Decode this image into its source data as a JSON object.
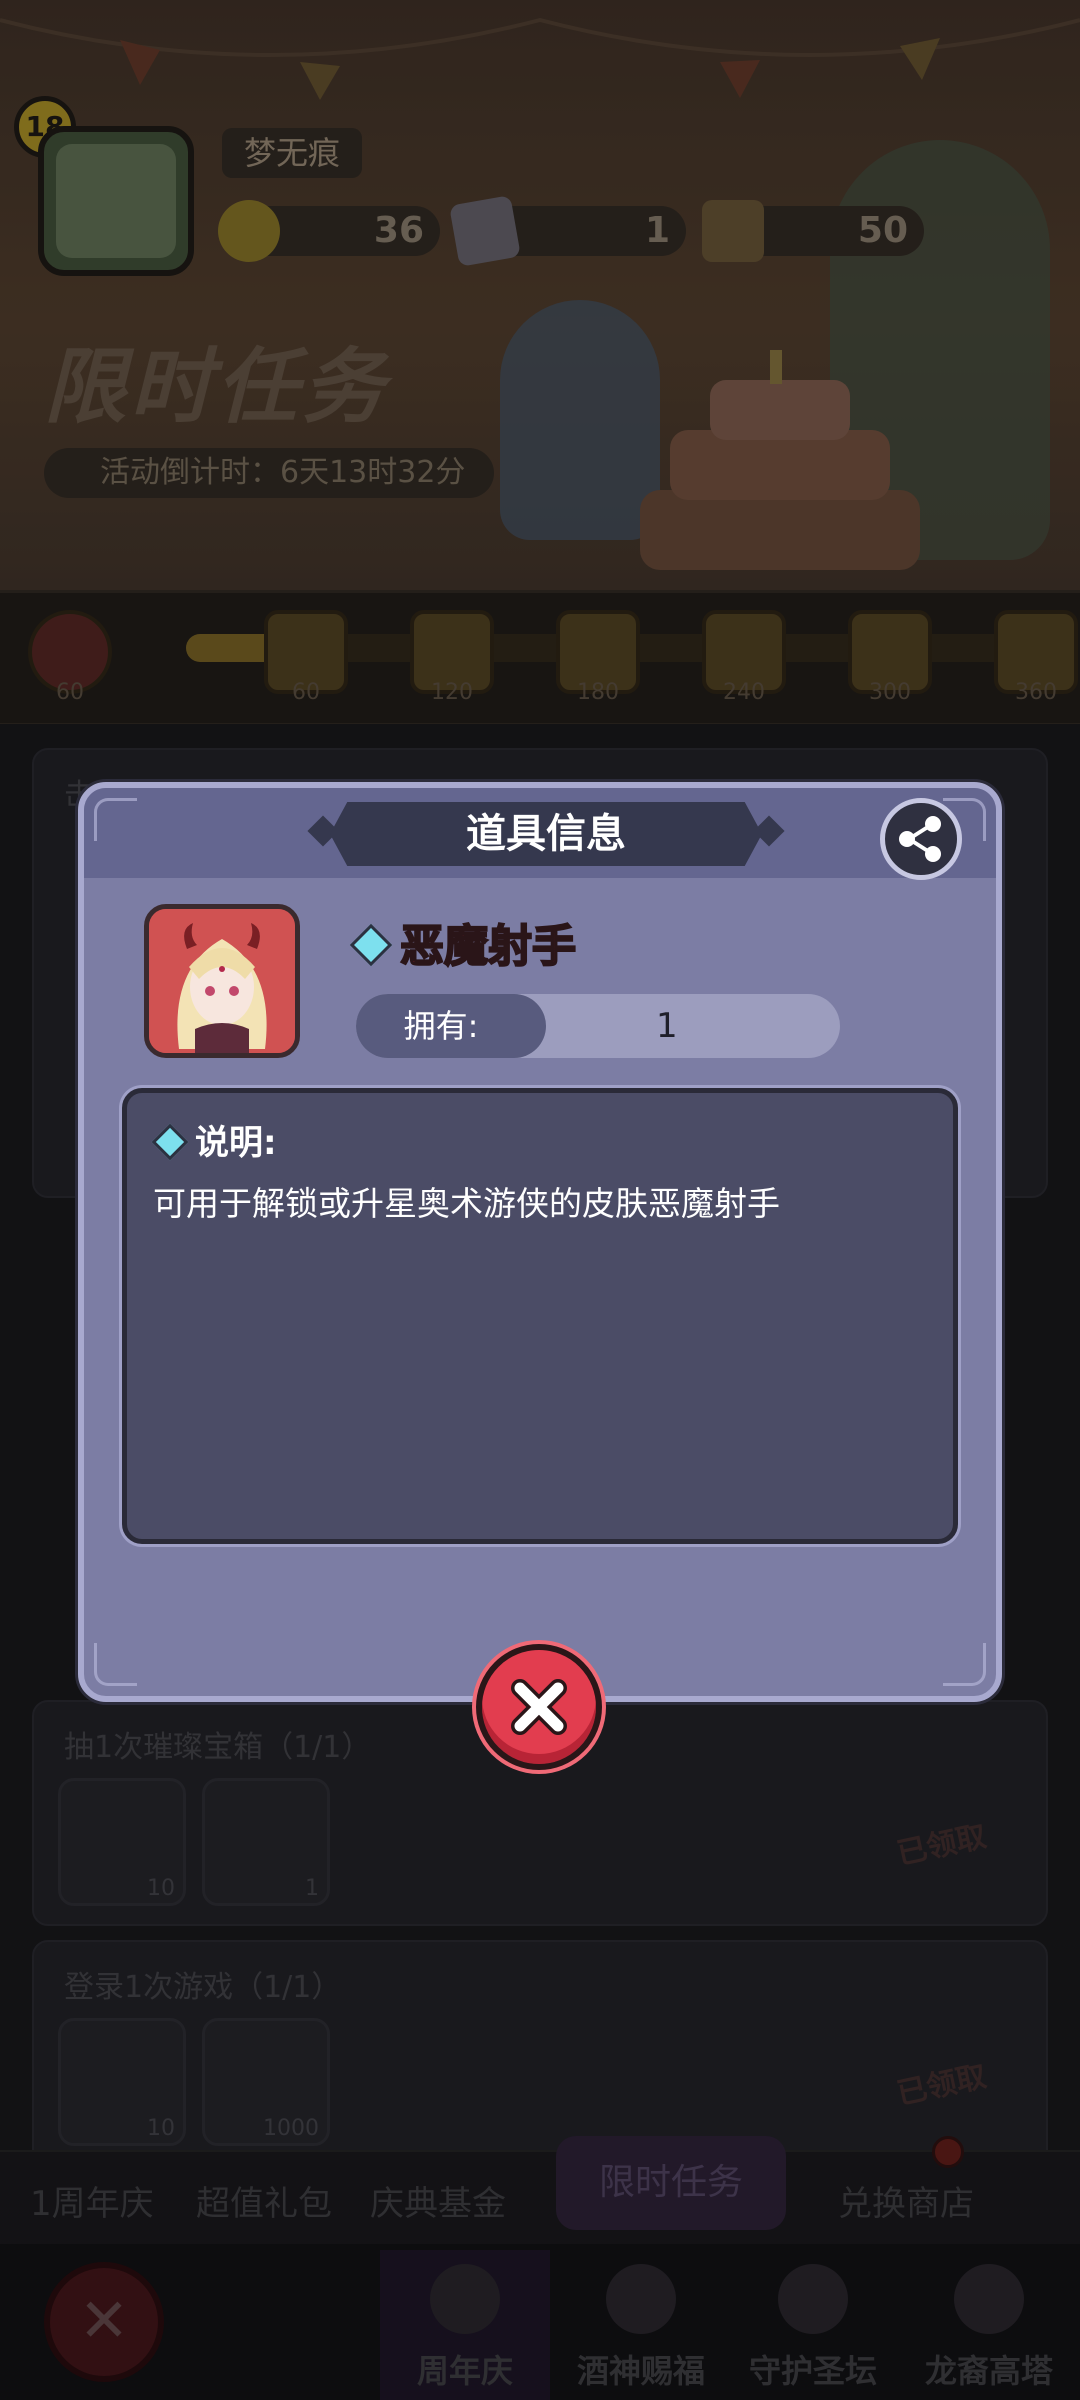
{
  "player": {
    "level": "18",
    "name": "梦无痕"
  },
  "resources": [
    {
      "name": "coin",
      "value": "36",
      "icon": "coin-icon",
      "color": "#8a7f2e"
    },
    {
      "name": "ticket",
      "value": "1",
      "icon": "ticket-icon",
      "color": "#6e6a74"
    },
    {
      "name": "lock-item",
      "value": "50",
      "icon": "lock-icon",
      "color": "#6b5a3c"
    }
  ],
  "event": {
    "title": "限时任务",
    "countdown": "活动倒计时：6天13时32分"
  },
  "milestones": [
    {
      "value": "60"
    },
    {
      "value": "60"
    },
    {
      "value": "120"
    },
    {
      "value": "180"
    },
    {
      "value": "240"
    },
    {
      "value": "300"
    },
    {
      "value": "360"
    }
  ],
  "tasks": [
    {
      "title": "击败1次精英怪物（0/1）"
    },
    {
      "title": "抽1次璀璨宝箱（1/1）",
      "rewards": [
        "10",
        "1"
      ],
      "status": "已领取"
    },
    {
      "title": "登录1次游戏（1/1）",
      "rewards": [
        "10",
        "1000"
      ],
      "status": "已领取"
    }
  ],
  "tabs": [
    "1周年庆",
    "超值礼包",
    "庆典基金",
    "限时任务",
    "兑换商店"
  ],
  "bottom_nav": [
    "周年庆",
    "酒神赐福",
    "守护圣坛",
    "龙裔高塔"
  ],
  "modal": {
    "title": "道具信息",
    "item_name": "恶魔射手",
    "own_label": "拥有:",
    "own_value": "1",
    "desc_title": "说明:",
    "desc_text": "可用于解锁或升星奥术游侠的皮肤恶魔射手"
  },
  "colors": {
    "modal_bg": "#7c7da4",
    "item_name": "#ff2b3a",
    "close_button": "#e23d4f"
  }
}
